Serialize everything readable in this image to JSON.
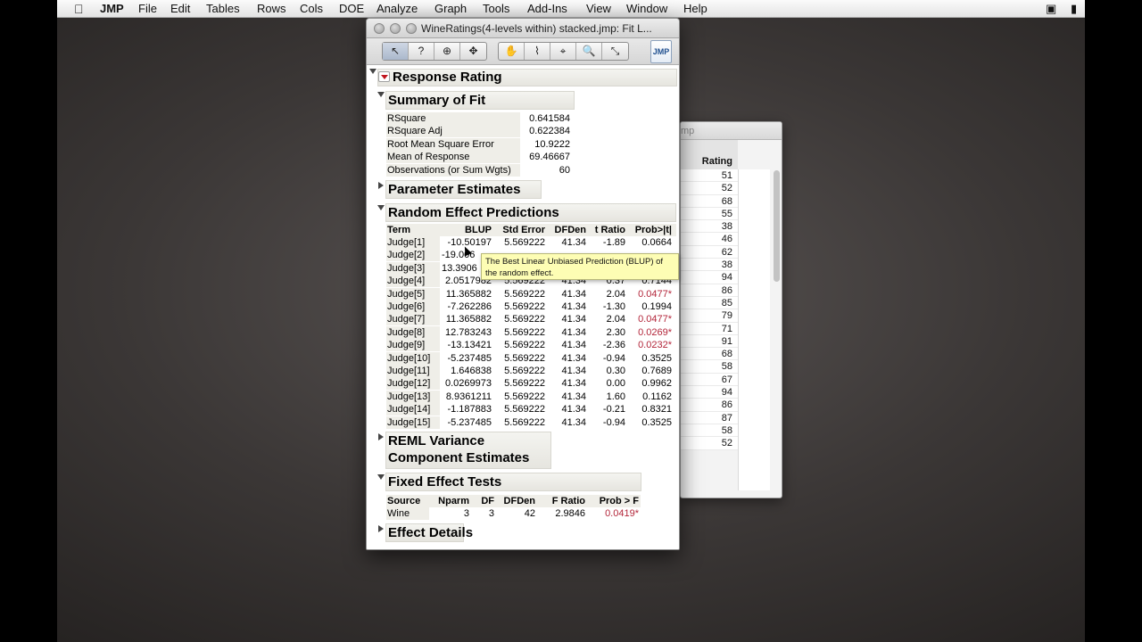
{
  "menubar": {
    "app": "JMP",
    "items": [
      "File",
      "Edit",
      "Tables",
      "Rows",
      "Cols",
      "DOE",
      "Analyze",
      "Graph",
      "Tools",
      "Add-Ins",
      "View",
      "Window",
      "Help"
    ]
  },
  "data_window": {
    "title_fragment": "mp",
    "column_header": "Rating",
    "values": [
      "51",
      "52",
      "68",
      "55",
      "38",
      "46",
      "62",
      "38",
      "94",
      "86",
      "85",
      "79",
      "71",
      "91",
      "68",
      "58",
      "67",
      "94",
      "86",
      "87",
      "58",
      "52"
    ]
  },
  "report_window": {
    "title": "WineRatings(4-levels within) stacked.jmp: Fit L...",
    "toolbar": {
      "group1": [
        "↖",
        "?",
        "⊕",
        "✥"
      ],
      "group2": [
        "✋",
        "⌇",
        "⌖",
        "🔍",
        "⤡"
      ],
      "jmp_icon_label": "JMP"
    },
    "response": {
      "title": "Response Rating"
    },
    "summary_of_fit": {
      "title": "Summary of Fit",
      "rows": [
        {
          "label": "RSquare",
          "value": "0.641584"
        },
        {
          "label": "RSquare Adj",
          "value": "0.622384"
        },
        {
          "label": "Root Mean Square Error",
          "value": "10.9222"
        },
        {
          "label": "Mean of Response",
          "value": "69.46667"
        },
        {
          "label": "Observations (or Sum Wgts)",
          "value": "60"
        }
      ]
    },
    "parameter_estimates": {
      "title": "Parameter Estimates"
    },
    "random_effect_predictions": {
      "title": "Random Effect Predictions",
      "headers": [
        "Term",
        "BLUP",
        "Std Error",
        "DFDen",
        "t Ratio",
        "Prob>|t|"
      ],
      "rows": [
        {
          "term": "Judge[1]",
          "blup": "-10.50197",
          "se": "5.569222",
          "df": "41.34",
          "t": "-1.89",
          "p": "0.0664",
          "sig": false
        },
        {
          "term": "Judge[2]",
          "blup": "-19.006",
          "se": "",
          "df": "",
          "t": "",
          "p": "",
          "sig": false
        },
        {
          "term": "Judge[3]",
          "blup": "13.3906",
          "se": "",
          "df": "",
          "t": "",
          "p": "",
          "sig": false
        },
        {
          "term": "Judge[4]",
          "blup": "2.0517982",
          "se": "5.569222",
          "df": "41.34",
          "t": "0.37",
          "p": "0.7144",
          "sig": false
        },
        {
          "term": "Judge[5]",
          "blup": "11.365882",
          "se": "5.569222",
          "df": "41.34",
          "t": "2.04",
          "p": "0.0477*",
          "sig": true
        },
        {
          "term": "Judge[6]",
          "blup": "-7.262286",
          "se": "5.569222",
          "df": "41.34",
          "t": "-1.30",
          "p": "0.1994",
          "sig": false
        },
        {
          "term": "Judge[7]",
          "blup": "11.365882",
          "se": "5.569222",
          "df": "41.34",
          "t": "2.04",
          "p": "0.0477*",
          "sig": true
        },
        {
          "term": "Judge[8]",
          "blup": "12.783243",
          "se": "5.569222",
          "df": "41.34",
          "t": "2.30",
          "p": "0.0269*",
          "sig": true
        },
        {
          "term": "Judge[9]",
          "blup": "-13.13421",
          "se": "5.569222",
          "df": "41.34",
          "t": "-2.36",
          "p": "0.0232*",
          "sig": true
        },
        {
          "term": "Judge[10]",
          "blup": "-5.237485",
          "se": "5.569222",
          "df": "41.34",
          "t": "-0.94",
          "p": "0.3525",
          "sig": false
        },
        {
          "term": "Judge[11]",
          "blup": "1.646838",
          "se": "5.569222",
          "df": "41.34",
          "t": "0.30",
          "p": "0.7689",
          "sig": false
        },
        {
          "term": "Judge[12]",
          "blup": "0.0269973",
          "se": "5.569222",
          "df": "41.34",
          "t": "0.00",
          "p": "0.9962",
          "sig": false
        },
        {
          "term": "Judge[13]",
          "blup": "8.9361211",
          "se": "5.569222",
          "df": "41.34",
          "t": "1.60",
          "p": "0.1162",
          "sig": false
        },
        {
          "term": "Judge[14]",
          "blup": "-1.187883",
          "se": "5.569222",
          "df": "41.34",
          "t": "-0.21",
          "p": "0.8321",
          "sig": false
        },
        {
          "term": "Judge[15]",
          "blup": "-5.237485",
          "se": "5.569222",
          "df": "41.34",
          "t": "-0.94",
          "p": "0.3525",
          "sig": false
        }
      ]
    },
    "reml": {
      "title_line1": "REML Variance",
      "title_line2": "Component Estimates"
    },
    "fixed_effect_tests": {
      "title": "Fixed Effect Tests",
      "headers": [
        "Source",
        "Nparm",
        "DF",
        "DFDen",
        "F Ratio",
        "Prob > F"
      ],
      "row": {
        "source": "Wine",
        "nparm": "3",
        "df": "3",
        "dfden": "42",
        "f": "2.9846",
        "p": "0.0419*"
      }
    },
    "effect_details": {
      "title": "Effect Details"
    }
  },
  "tooltip": {
    "line1": "The Best Linear Unbiased Prediction (BLUP) of",
    "line2": "the random effect."
  },
  "colors": {
    "significant": "#b3263a",
    "tooltip_bg": "#fdfdb4",
    "header_bg": "#efeee8"
  }
}
